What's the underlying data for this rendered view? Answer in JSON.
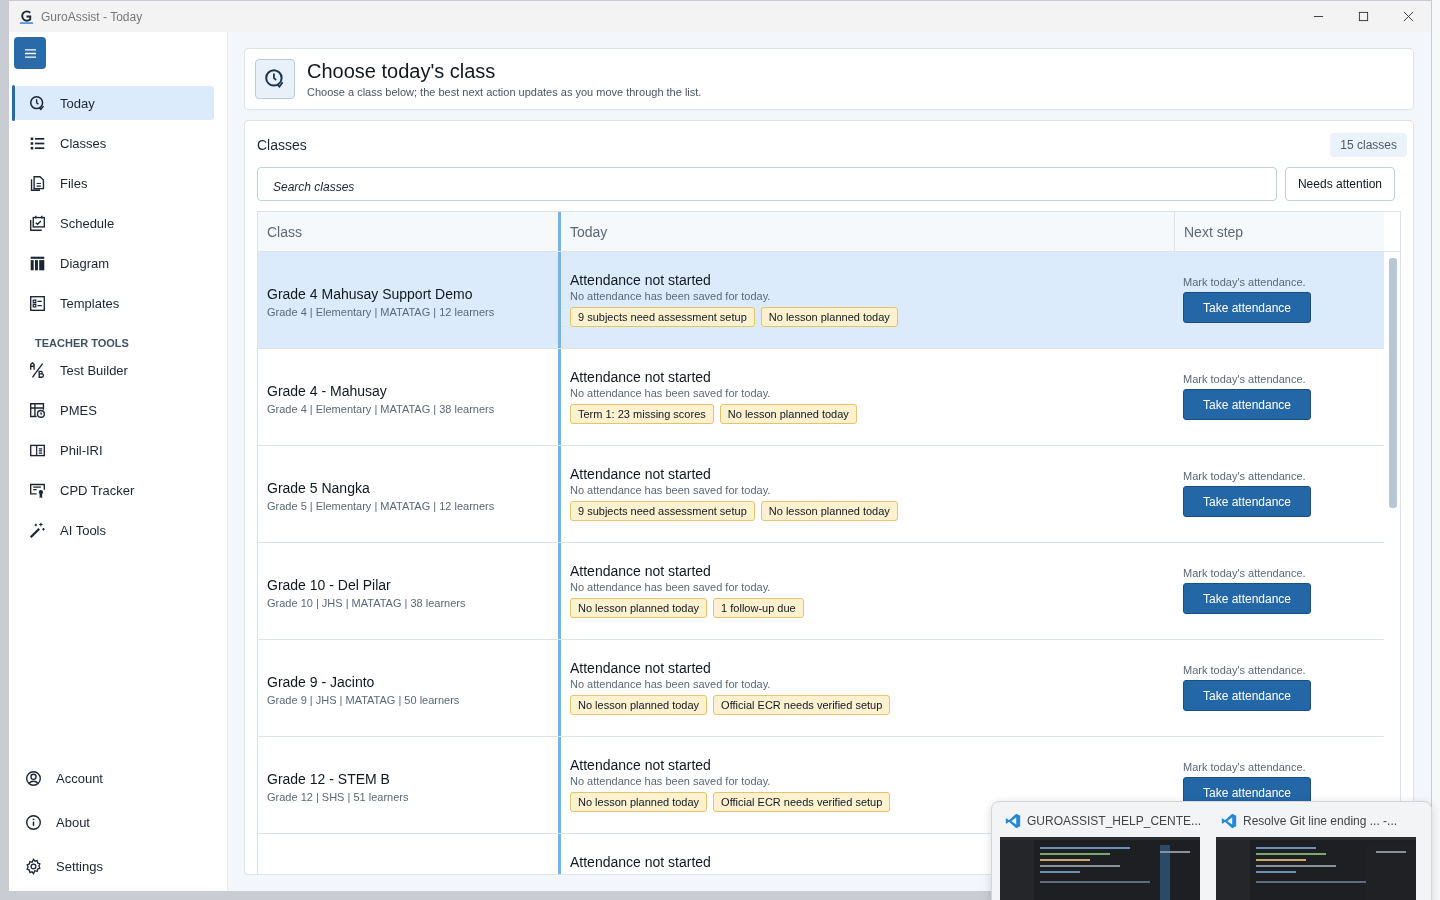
{
  "window": {
    "title": "GuroAssist - Today"
  },
  "sidebar": {
    "items": [
      {
        "label": "Today",
        "selected": true
      },
      {
        "label": "Classes",
        "selected": false
      },
      {
        "label": "Files",
        "selected": false
      },
      {
        "label": "Schedule",
        "selected": false
      },
      {
        "label": "Diagram",
        "selected": false
      },
      {
        "label": "Templates",
        "selected": false
      }
    ],
    "section_heading": "TEACHER TOOLS",
    "tools": [
      {
        "label": "Test Builder",
        "selected": false
      },
      {
        "label": "PMES",
        "selected": false
      },
      {
        "label": "Phil-IRI",
        "selected": false
      },
      {
        "label": "CPD Tracker",
        "selected": false
      },
      {
        "label": "AI Tools",
        "selected": false
      }
    ],
    "bottom_items": [
      {
        "label": "Account",
        "selected": false
      },
      {
        "label": "About",
        "selected": false
      },
      {
        "label": "Settings",
        "selected": false
      }
    ]
  },
  "header": {
    "title": "Choose today's class",
    "subtitle": "Choose a class below; the best next action updates as you move through the list."
  },
  "classes_panel": {
    "title": "Classes",
    "count": "15 classes",
    "search": {
      "placeholder": "Search classes"
    },
    "filter_button": "Needs attention"
  },
  "table": {
    "columns": [
      "Class",
      "Today",
      "Next step"
    ],
    "rows": [
      {
        "selected": true,
        "name": "Grade 4 Mahusay Support Demo",
        "details": "Grade 4 | Elementary | MATATAG | 12 learners",
        "status": "Attendance not started",
        "status_detail": "No attendance has been saved for today.",
        "tags": [
          "9 subjects need assessment setup",
          "No lesson planned today"
        ],
        "next_hint": "Mark today's attendance.",
        "action": "Take attendance"
      },
      {
        "selected": false,
        "name": "Grade 4 - Mahusay",
        "details": "Grade 4 | Elementary | MATATAG | 38 learners",
        "status": "Attendance not started",
        "status_detail": "No attendance has been saved for today.",
        "tags": [
          "Term 1: 23 missing scores",
          "No lesson planned today"
        ],
        "next_hint": "Mark today's attendance.",
        "action": "Take attendance"
      },
      {
        "selected": false,
        "name": "Grade 5 Nangka",
        "details": "Grade 5 | Elementary | MATATAG | 12 learners",
        "status": "Attendance not started",
        "status_detail": "No attendance has been saved for today.",
        "tags": [
          "9 subjects need assessment setup",
          "No lesson planned today"
        ],
        "next_hint": "Mark today's attendance.",
        "action": "Take attendance"
      },
      {
        "selected": false,
        "name": "Grade 10 - Del Pilar",
        "details": "Grade 10 | JHS | MATATAG | 38 learners",
        "status": "Attendance not started",
        "status_detail": "No attendance has been saved for today.",
        "tags": [
          "No lesson planned today",
          "1 follow-up due"
        ],
        "next_hint": "Mark today's attendance.",
        "action": "Take attendance"
      },
      {
        "selected": false,
        "name": "Grade 9 - Jacinto",
        "details": "Grade 9 | JHS | MATATAG | 50 learners",
        "status": "Attendance not started",
        "status_detail": "No attendance has been saved for today.",
        "tags": [
          "No lesson planned today",
          "Official ECR needs verified setup"
        ],
        "next_hint": "Mark today's attendance.",
        "action": "Take attendance"
      },
      {
        "selected": false,
        "name": "Grade 12 - STEM B",
        "details": "Grade 12 | SHS | 51 learners",
        "status": "Attendance not started",
        "status_detail": "No attendance has been saved for today.",
        "tags": [
          "No lesson planned today",
          "Official ECR needs verified setup"
        ],
        "next_hint": "Mark today's attendance.",
        "action": "Take attendance"
      },
      {
        "selected": false,
        "status": "Attendance not started"
      }
    ]
  },
  "taskbar_preview": {
    "windows": [
      {
        "title": "GUROASSIST_HELP_CENTE..."
      },
      {
        "title": "Resolve Git line ending ... -..."
      }
    ]
  }
}
